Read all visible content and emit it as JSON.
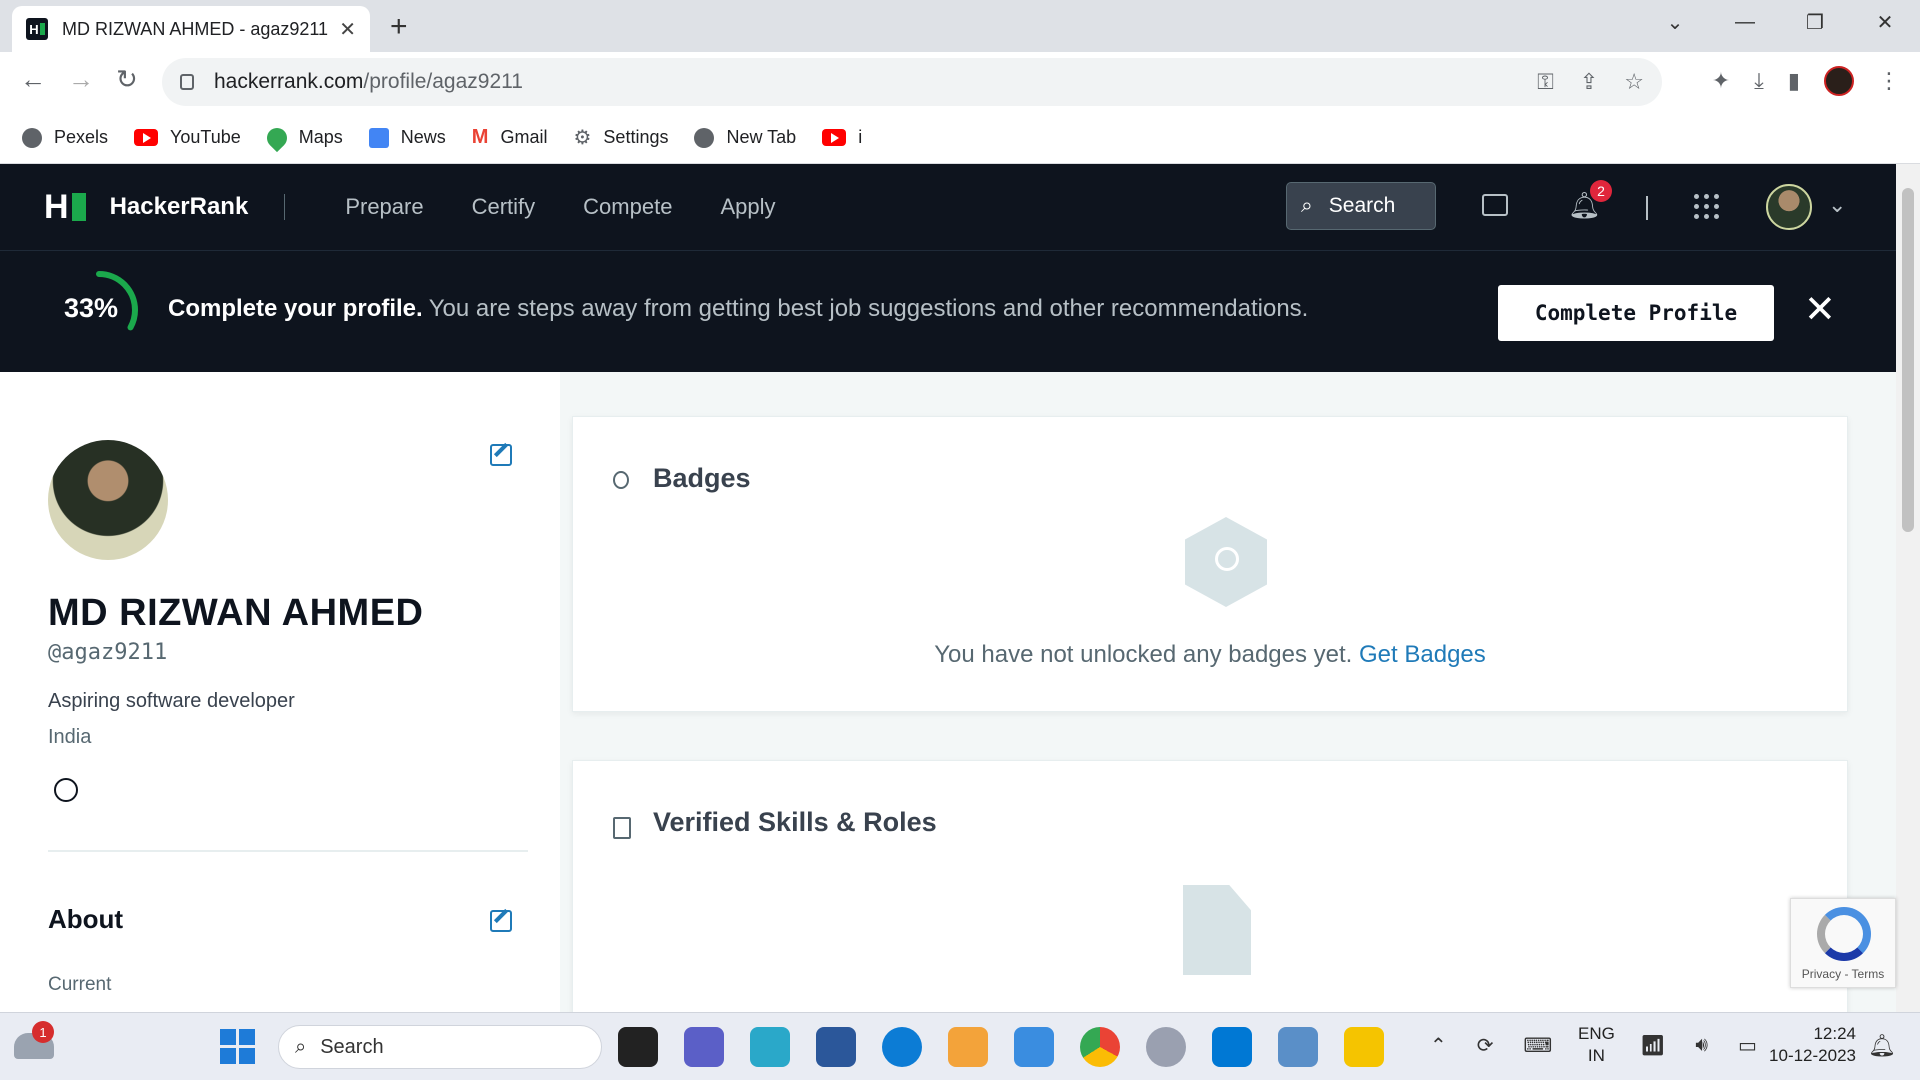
{
  "browser": {
    "tab_title": "MD RIZWAN AHMED - agaz9211",
    "url_host": "hackerrank.com",
    "url_path": "/profile/agaz9211",
    "bookmarks": [
      {
        "label": "Pexels",
        "icon": "globe-icon"
      },
      {
        "label": "YouTube",
        "icon": "youtube-icon"
      },
      {
        "label": "Maps",
        "icon": "maps-icon"
      },
      {
        "label": "News",
        "icon": "news-icon"
      },
      {
        "label": "Gmail",
        "icon": "gmail-icon"
      },
      {
        "label": "Settings",
        "icon": "gear-icon"
      },
      {
        "label": "New Tab",
        "icon": "globe-icon"
      },
      {
        "label": "i",
        "icon": "youtube-icon"
      }
    ]
  },
  "header": {
    "brand": "HackerRank",
    "nav": [
      "Prepare",
      "Certify",
      "Compete",
      "Apply"
    ],
    "search_label": "Search",
    "notification_count": "2"
  },
  "banner": {
    "percent": "33%",
    "progress": 0.33,
    "title": "Complete your profile.",
    "message": "You are steps away from getting best job suggestions and other recommendations.",
    "button": "Complete Profile"
  },
  "profile": {
    "name": "MD RIZWAN AHMED",
    "handle": "@agaz9211",
    "bio": "Aspiring software developer",
    "country": "India",
    "about_title": "About",
    "current_label": "Current"
  },
  "badges": {
    "title": "Badges",
    "empty_text": "You have not unlocked any badges yet.",
    "link": "Get Badges"
  },
  "skills": {
    "title": "Verified Skills & Roles"
  },
  "recaptcha": {
    "text": "Privacy - Terms"
  },
  "taskbar": {
    "weather_badge": "1",
    "search_label": "Search",
    "lang_line1": "ENG",
    "lang_line2": "IN",
    "time": "12:24",
    "date": "10-12-2023"
  },
  "colors": {
    "hr_dark": "#0e141e",
    "hr_green": "#1ba94c",
    "link_blue": "#1f7ab8"
  }
}
